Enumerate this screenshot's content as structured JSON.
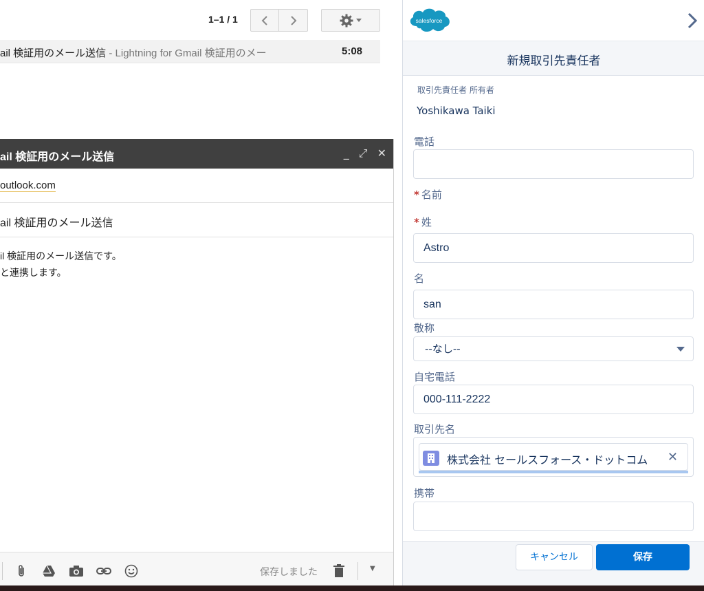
{
  "gmail": {
    "pager": "1–1 / 1",
    "mail_row": {
      "subject": "ail 検証用のメール送信",
      "snippet": " - Lightning for Gmail 検証用のメー",
      "time": "5:08"
    },
    "compose": {
      "title": "ail 検証用のメール送信",
      "to": "outlook.com",
      "subject": "ail 検証用のメール送信",
      "body_line1": "il 検証用のメール送信です。",
      "body_line2": "と連携します。",
      "saved_status": "保存しました"
    }
  },
  "salesforce": {
    "logo_text": "salesforce",
    "title": "新規取引先責任者",
    "owner_label": "取引先責任者 所有者",
    "owner_value": "Yoshikawa Taiki",
    "fields": {
      "phone_label": "電話",
      "phone_value": "",
      "name_label": "名前",
      "lastname_label": "姓",
      "lastname_value": "Astro",
      "firstname_label": "名",
      "firstname_value": "san",
      "salutation_label": "敬称",
      "salutation_value": "--なし--",
      "homephone_label": "自宅電話",
      "homephone_value": "000-111-2222",
      "account_label": "取引先名",
      "account_value": "株式会社 セールスフォース・ドットコム",
      "mobile_label": "携帯",
      "mobile_value": ""
    },
    "cancel_label": "キャンセル",
    "save_label": "保存"
  },
  "colors": {
    "salesforce_blue": "#0070d2",
    "label_gray": "#54698d",
    "text_dark": "#16325c",
    "required_red": "#c23934",
    "gmail_header": "#404040"
  }
}
